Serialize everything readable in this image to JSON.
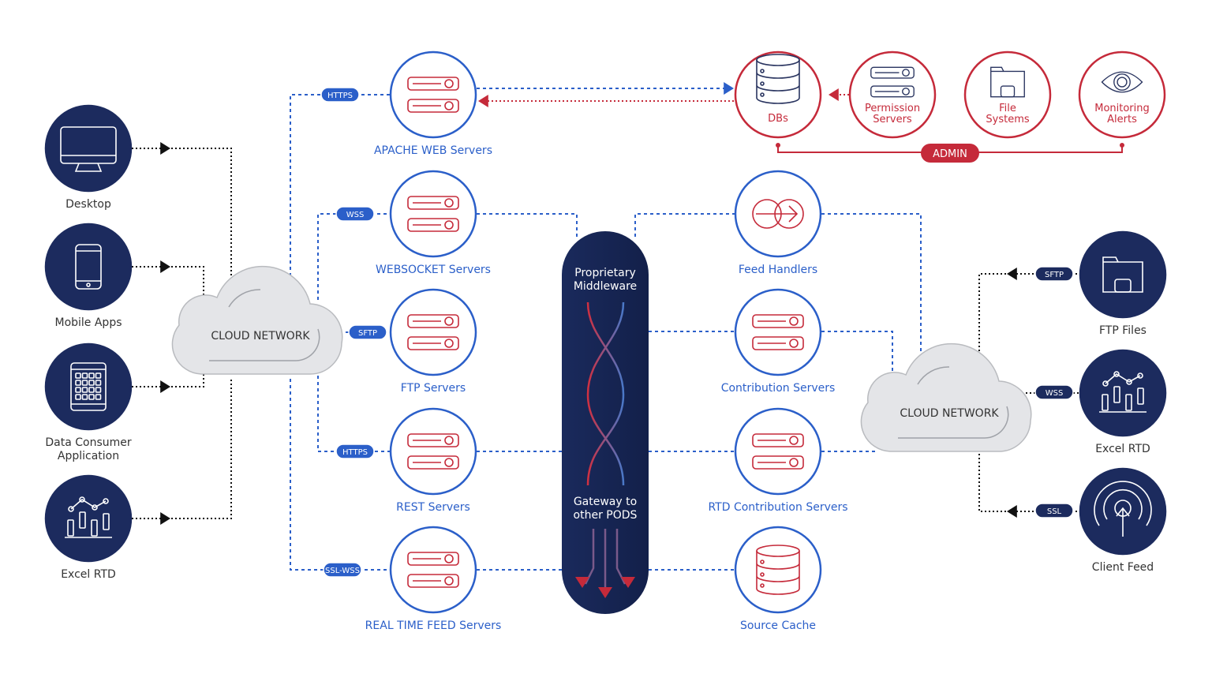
{
  "colors": {
    "navy": "#1c2b5e",
    "blue": "#2b5fc9",
    "red": "#c52a3a",
    "cloud": "#e4e5e8",
    "black": "#111111"
  },
  "left_clients": [
    {
      "label": [
        "Desktop"
      ],
      "icon": "desktop-icon"
    },
    {
      "label": [
        "Mobile Apps"
      ],
      "icon": "mobile-icon"
    },
    {
      "label": [
        "Data Consumer",
        "Application"
      ],
      "icon": "tablet-icon"
    },
    {
      "label": [
        "Excel RTD"
      ],
      "icon": "chart-icon"
    }
  ],
  "left_cloud": "CLOUD NETWORK",
  "right_cloud": "CLOUD NETWORK",
  "servers": [
    {
      "label": "APACHE WEB Servers",
      "protocol": "HTTPS"
    },
    {
      "label": "WEBSOCKET Servers",
      "protocol": "WSS"
    },
    {
      "label": "FTP Servers",
      "protocol": "SFTP"
    },
    {
      "label": "REST Servers",
      "protocol": "HTTPS"
    },
    {
      "label": "REAL TIME FEED Servers",
      "protocol": "SSL-WSS"
    }
  ],
  "middleware": {
    "top": [
      "Proprietary",
      "Middleware"
    ],
    "bottom": [
      "Gateway to",
      "other PODS"
    ]
  },
  "right_services": [
    {
      "label": "Feed Handlers",
      "icon": "feed-icon"
    },
    {
      "label": "Contribution Servers",
      "icon": "server-icon"
    },
    {
      "label": "RTD Contribution Servers",
      "icon": "server-icon"
    },
    {
      "label": "Source Cache",
      "icon": "database-icon"
    }
  ],
  "admin_nodes": [
    {
      "label": [
        "DBs"
      ],
      "icon": "database-icon"
    },
    {
      "label": [
        "Permission",
        "Servers"
      ],
      "icon": "server-icon"
    },
    {
      "label": [
        "File",
        "Systems"
      ],
      "icon": "folder-icon"
    },
    {
      "label": [
        "Monitoring",
        "Alerts"
      ],
      "icon": "eye-icon"
    }
  ],
  "admin_label": "ADMIN",
  "right_clients": [
    {
      "label": "FTP Files",
      "protocol": "SFTP",
      "icon": "folder-icon"
    },
    {
      "label": "Excel RTD",
      "protocol": "WSS",
      "icon": "chart-icon"
    },
    {
      "label": "Client Feed",
      "protocol": "SSL",
      "icon": "signal-icon"
    }
  ]
}
